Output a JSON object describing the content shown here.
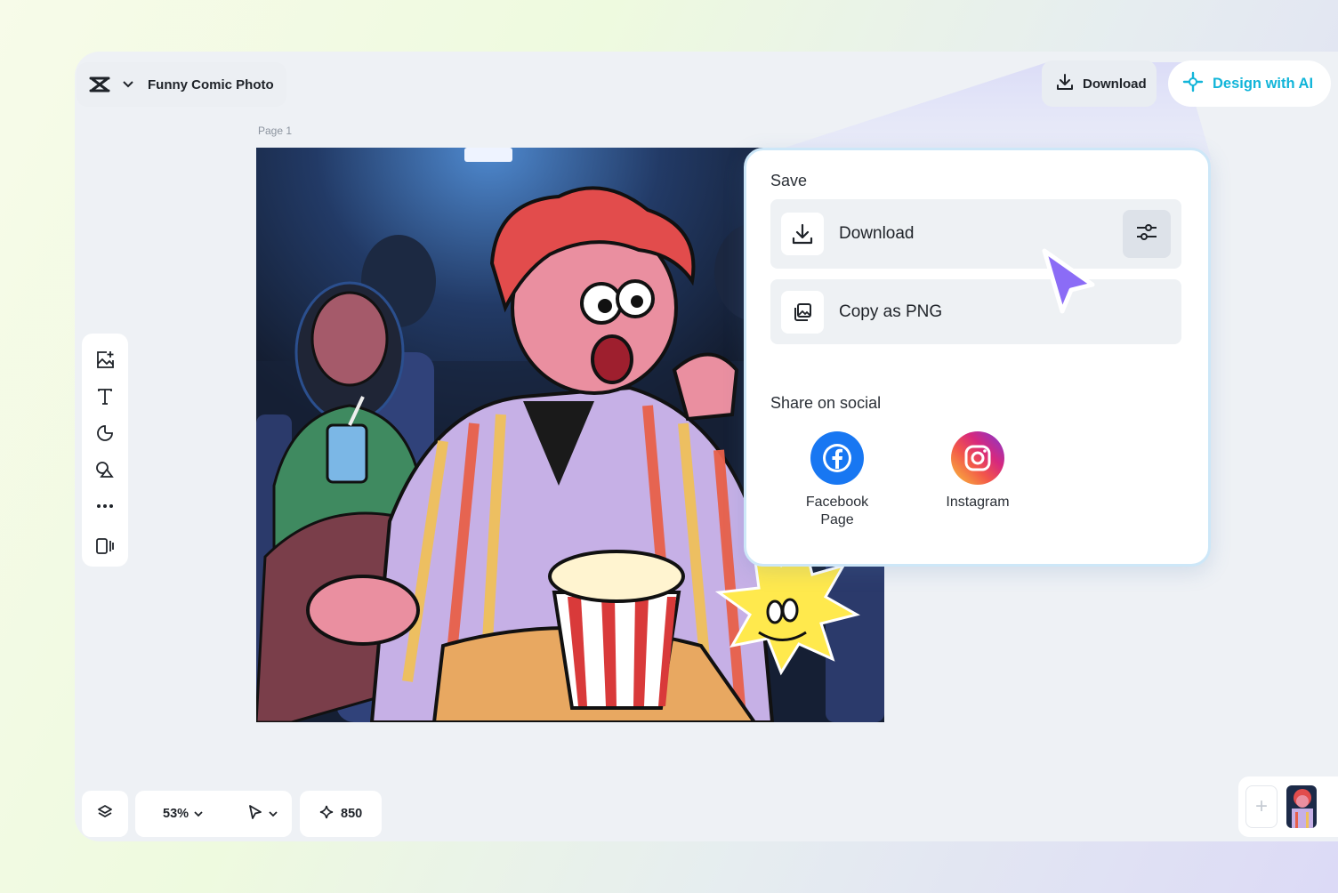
{
  "header": {
    "project_title": "Funny Comic Photo",
    "download_label": "Download",
    "design_ai_label": "Design with AI"
  },
  "canvas": {
    "page_label": "Page 1"
  },
  "bottom_bar": {
    "zoom": "53%",
    "credits": "850"
  },
  "export_popup": {
    "save_heading": "Save",
    "download_label": "Download",
    "copy_png_label": "Copy as PNG",
    "share_heading": "Share on social",
    "socials": [
      {
        "name": "Facebook\nPage",
        "icon": "facebook-icon",
        "color": "#1877f2"
      },
      {
        "name": "Instagram",
        "icon": "instagram-icon",
        "color": "#e1306c"
      }
    ]
  },
  "colors": {
    "accent_ai": "#12b5d9",
    "cursor": "#8b6cf6"
  }
}
